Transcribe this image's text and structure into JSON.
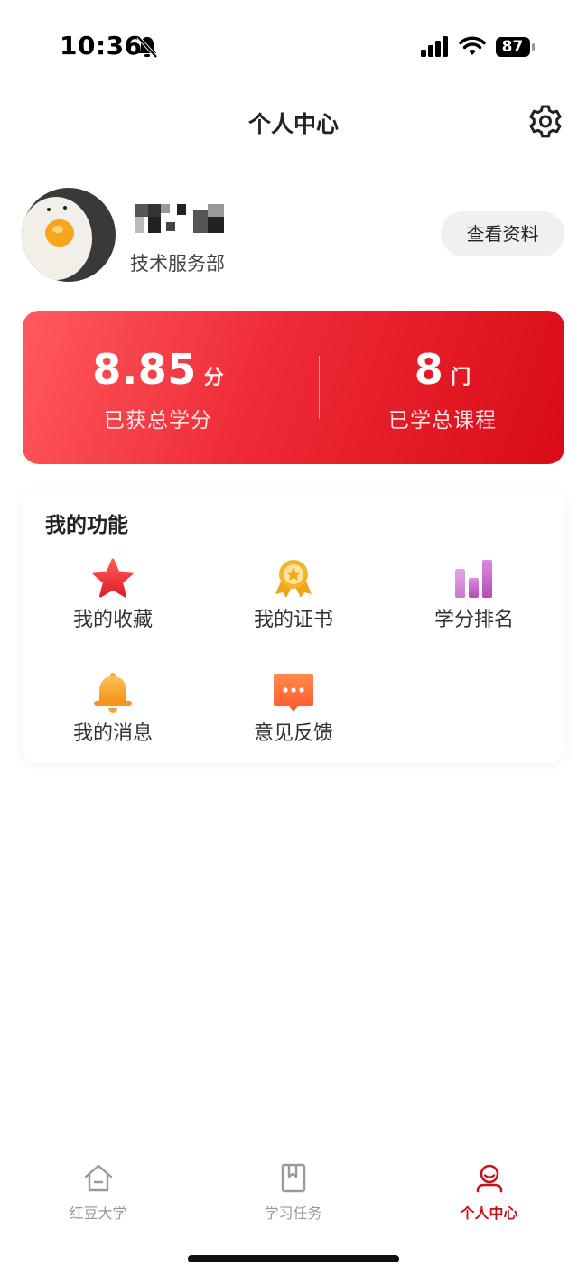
{
  "status_bar": {
    "time": "10:36",
    "battery": "87"
  },
  "header": {
    "title": "个人中心"
  },
  "profile": {
    "department": "技术服务部",
    "view_profile_label": "查看资料"
  },
  "stats": [
    {
      "value": "8.85",
      "unit": "分",
      "label": "已获总学分"
    },
    {
      "value": "8",
      "unit": "门",
      "label": "已学总课程"
    }
  ],
  "features": {
    "title": "我的功能",
    "items": [
      {
        "label": "我的收藏",
        "icon": "star-icon",
        "color": "#f0373f"
      },
      {
        "label": "我的证书",
        "icon": "medal-icon",
        "color": "#f5b42a"
      },
      {
        "label": "学分排名",
        "icon": "bar-chart-icon",
        "color": "#c35fc2"
      },
      {
        "label": "我的消息",
        "icon": "bell-icon",
        "color": "#f9a23b"
      },
      {
        "label": "意见反馈",
        "icon": "chat-icon",
        "color": "#ff6f3c"
      }
    ]
  },
  "tabs": [
    {
      "label": "红豆大学",
      "icon": "home-icon",
      "active": false
    },
    {
      "label": "学习任务",
      "icon": "book-icon",
      "active": false
    },
    {
      "label": "个人中心",
      "icon": "user-icon",
      "active": true
    }
  ],
  "colors": {
    "accent": "#c8101a",
    "card_gradient_start": "#ff5a5f",
    "card_gradient_end": "#d90b16"
  }
}
